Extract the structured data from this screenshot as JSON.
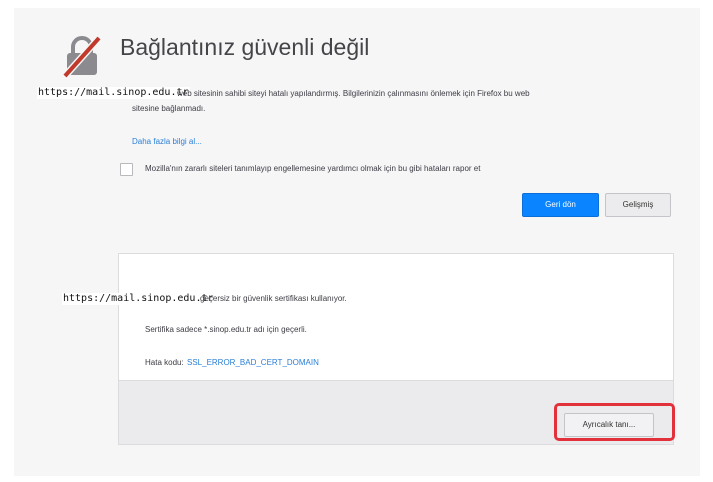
{
  "page": {
    "title": "Bağlantınız güvenli değil",
    "url_overlay_1": "https://mail.sinop.edu.tr",
    "description_line1": "web sitesinin sahibi siteyi hatalı yapılandırmış. Bilgilerinizin çalınmasını önlemek için Firefox bu web",
    "description_line2": "sitesine bağlanmadı.",
    "learn_more": "Daha fazla bilgi al...",
    "report_checkbox_label": "Mozilla'nın zararlı siteleri tanımlayıp engellemesine yardımcı olmak için bu gibi hataları rapor et",
    "checkbox_checked": false,
    "go_back_button": "Geri dön",
    "advanced_toggle_button": "Gelişmiş"
  },
  "details": {
    "url_overlay_2": "https://mail.sinop.edu.tr",
    "invalid_cert_text": "geçersiz bir güvenlik sertifikası kullanıyor.",
    "cert_valid_for": "Sertifika sadece *.sinop.edu.tr adı için geçerli.",
    "error_code_label": "Hata kodu:",
    "error_code": "SSL_ERROR_BAD_CERT_DOMAIN",
    "add_exception_button": "Ayrıcalık tanı..."
  },
  "colors": {
    "accent": "#0a84ff",
    "link": "#2a7fd8",
    "highlight": "#e3313b",
    "lock_icon": "#b23030"
  }
}
